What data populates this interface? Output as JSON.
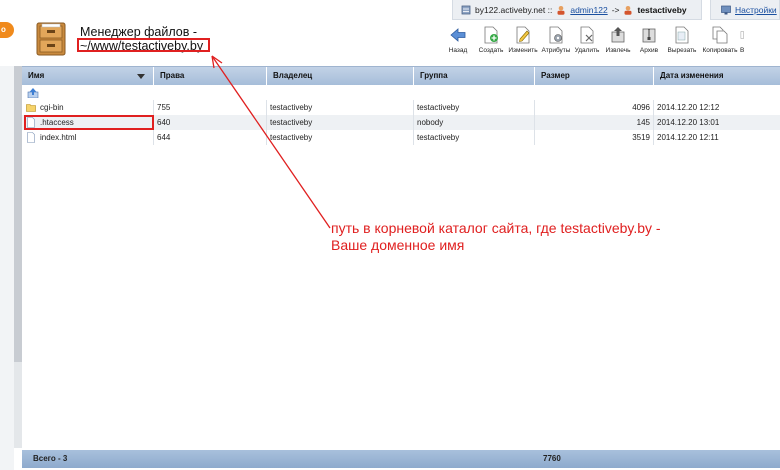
{
  "topbar": {
    "host": "by122.activeby.net ::",
    "admin_user": "admin122",
    "separator": "->",
    "current_user": "testactiveby",
    "settings_label": "Настройки"
  },
  "header": {
    "title_line1": "Менеджер файлов -",
    "title_line2": "~/www/testactiveby.by",
    "corner_logo": "o"
  },
  "toolbar": {
    "items": [
      {
        "label": "Назад",
        "icon": "back-arrow-icon"
      },
      {
        "label": "Создать",
        "icon": "create-icon"
      },
      {
        "label": "Изменить",
        "icon": "edit-icon"
      },
      {
        "label": "Атрибуты",
        "icon": "attributes-icon"
      },
      {
        "label": "Удалить",
        "icon": "delete-icon"
      },
      {
        "label": "Извлечь",
        "icon": "extract-icon"
      },
      {
        "label": "Архив",
        "icon": "archive-icon"
      },
      {
        "label": "Вырезать",
        "icon": "cut-icon"
      },
      {
        "label": "Копировать",
        "icon": "copy-icon"
      },
      {
        "label": "В",
        "icon": "paste-icon"
      }
    ]
  },
  "table": {
    "columns": [
      "Имя",
      "Права",
      "Владелец",
      "Группа",
      "Размер",
      "Дата изменения"
    ],
    "rows": [
      {
        "name": "cgi-bin",
        "type": "folder",
        "perms": "755",
        "owner": "testactiveby",
        "group": "testactiveby",
        "size": "4096",
        "date": "2014.12.20 12:12"
      },
      {
        "name": ".htaccess",
        "type": "file",
        "perms": "640",
        "owner": "testactiveby",
        "group": "nobody",
        "size": "145",
        "date": "2014.12.20 13:01"
      },
      {
        "name": "index.html",
        "type": "file",
        "perms": "644",
        "owner": "testactiveby",
        "group": "testactiveby",
        "size": "3519",
        "date": "2014.12.20 12:11"
      }
    ],
    "footer_total": "Всего - 3",
    "footer_size": "7760"
  },
  "annotation": {
    "line1": "путь в корневой каталог сайта, где testactiveby.by -",
    "line2": "Ваше доменное имя"
  },
  "colors": {
    "annotation": "#e02020",
    "header_bg": "#b4c8e2",
    "link": "#1a4fa0"
  }
}
